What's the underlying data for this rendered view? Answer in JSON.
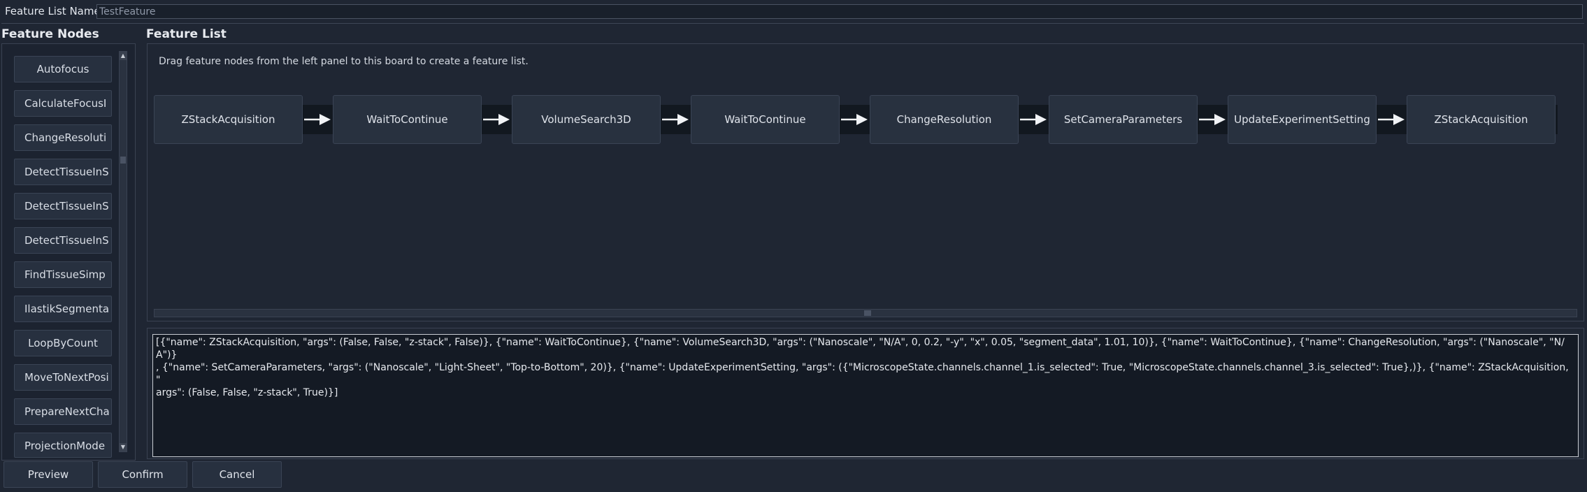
{
  "header": {
    "name_label": "Feature List Name",
    "name_value": "TestFeature"
  },
  "nodes_panel": {
    "title": "Feature Nodes",
    "items": [
      "Autofocus",
      "CalculateFocusI",
      "ChangeResoluti",
      "DetectTissueInS",
      "DetectTissueInS",
      "DetectTissueInS",
      "FindTissueSimp",
      "IlastikSegmenta",
      "LoopByCount",
      "MoveToNextPosi",
      "PrepareNextCha",
      "ProjectionMode"
    ]
  },
  "board": {
    "title": "Feature List",
    "hint": "Drag feature nodes from the left panel to this board to create a feature list.",
    "nodes": [
      "ZStackAcquisition",
      "WaitToContinue",
      "VolumeSearch3D",
      "WaitToContinue",
      "ChangeResolution",
      "SetCameraParameters",
      "UpdateExperimentSetting",
      "ZStackAcquisition"
    ]
  },
  "feature_text": "[{\"name\": ZStackAcquisition, \"args\": (False, False, \"z-stack\", False)}, {\"name\": WaitToContinue}, {\"name\": VolumeSearch3D, \"args\": (\"Nanoscale\", \"N/A\", 0, 0.2, \"-y\", \"x\", 0.05, \"segment_data\", 1.01, 10)}, {\"name\": WaitToContinue}, {\"name\": ChangeResolution, \"args\": (\"Nanoscale\", \"N/A\")}\n, {\"name\": SetCameraParameters, \"args\": (\"Nanoscale\", \"Light-Sheet\", \"Top-to-Bottom\", 20)}, {\"name\": UpdateExperimentSetting, \"args\": ({\"MicroscopeState.channels.channel_1.is_selected\": True, \"MicroscopeState.channels.channel_3.is_selected\": True},)}, {\"name\": ZStackAcquisition, \"\nargs\": (False, False, \"z-stack\", True)}]",
  "buttons": {
    "preview": "Preview",
    "confirm": "Confirm",
    "cancel": "Cancel"
  },
  "icons": {
    "scroll_up": "triangle-up-icon",
    "scroll_down": "triangle-down-icon",
    "flow_arrow": "arrow-right-icon"
  },
  "colors": {
    "background": "#1f2633",
    "panel": "#28313f",
    "track": "#121820",
    "text": "#dfe3ea"
  }
}
